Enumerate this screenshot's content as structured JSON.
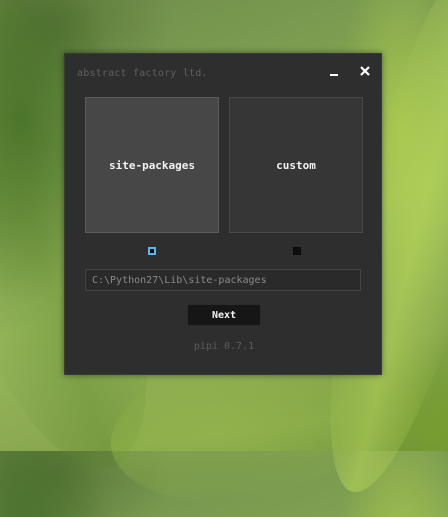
{
  "window": {
    "title": "abstract factory ltd."
  },
  "options": [
    {
      "label": "site-packages",
      "selected": true
    },
    {
      "label": "custom",
      "selected": false
    }
  ],
  "path_field": {
    "value": "C:\\Python27\\Lib\\site-packages"
  },
  "next_button": {
    "label": "Next"
  },
  "version": "pipi 0.7.1",
  "colors": {
    "window_bg": "#2e2e2e",
    "selected_indicator": "#5fb5e5"
  },
  "icons": {
    "minimize": "minimize-icon",
    "close": "close-icon"
  }
}
